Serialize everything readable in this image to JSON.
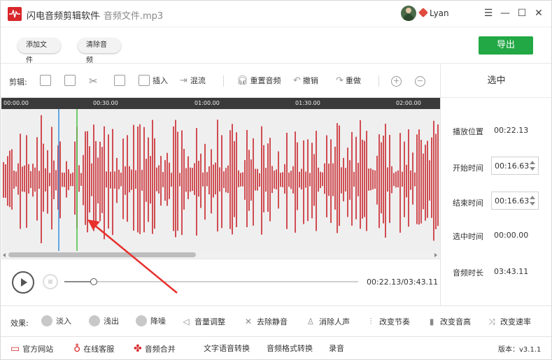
{
  "app": {
    "title": "闪电音频剪辑软件",
    "file_title": "- 音频文件.mp3",
    "username": "Lyan",
    "menu_icon": "☰",
    "min_icon": "—",
    "max_icon": "☐",
    "close_icon": "✕"
  },
  "topbar": {
    "add_file": "添加文件",
    "clear_audio": "清除音频",
    "export": "导出"
  },
  "editbar": {
    "label": "剪辑:",
    "insert": "插入",
    "mix": "混流",
    "reset_audio": "重置音频",
    "undo": "撤销",
    "redo": "重做"
  },
  "timeline": {
    "ticks": [
      "00:00.00",
      "00:30.00",
      "01:00.00",
      "01:30.00",
      "02:00.00"
    ]
  },
  "playback": {
    "readout": "00:22.13/03:43.11",
    "progress_fraction": 0.099
  },
  "panel": {
    "title": "选中",
    "play_position_label": "播放位置",
    "play_position_value": "00:22.13",
    "start_label": "开始时间",
    "start_value": "00:16.63",
    "end_label": "结束时间",
    "end_value": "00:16.63",
    "selected_label": "选中时间",
    "selected_value": "00:00.00",
    "duration_label": "音频时长",
    "duration_value": "03:43.11"
  },
  "effects": {
    "label": "效果:",
    "fade_in": "淡入",
    "fade_out": "浅出",
    "denoise": "降噪",
    "volume": "音量调整",
    "remove_silence": "去除静音",
    "remove_vocals": "消除人声",
    "change_tempo": "改变节奏",
    "change_pitch": "改变音高",
    "change_speed": "改变速率"
  },
  "bottom": {
    "website": "官方网站",
    "support": "在线客服",
    "merge": "音频合并",
    "tts": "文字语音转换",
    "convert": "音频格式转换",
    "record": "录音",
    "version": "版本：v3.1.1"
  },
  "colors": {
    "accent_red": "#d8262b",
    "export_green": "#22a845",
    "wave_red": "#c8242a",
    "cursor_blue": "#3a8fe0",
    "cursor_green": "#44c040"
  }
}
